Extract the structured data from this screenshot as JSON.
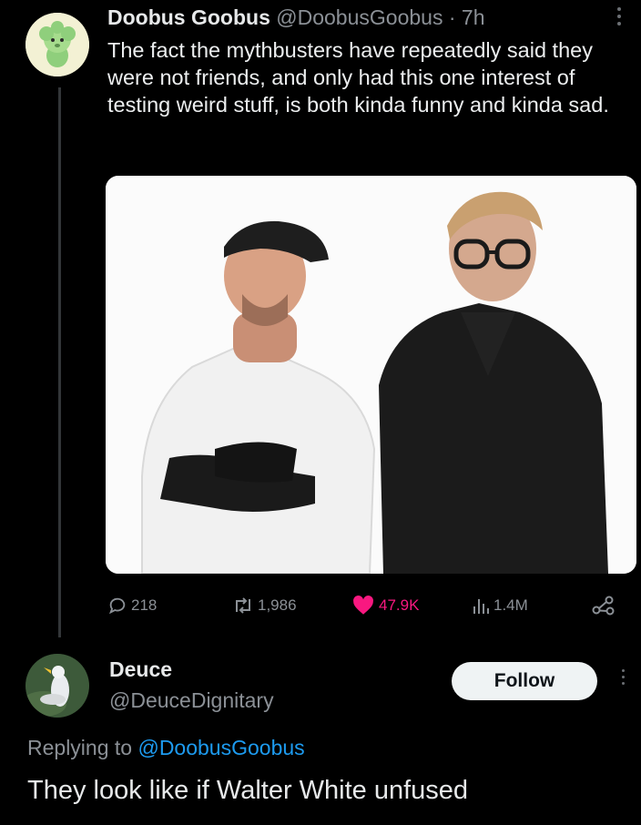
{
  "post": {
    "author_name": "Doobus Goobus",
    "author_handle": "@DoobusGoobus",
    "separator": "·",
    "time": "7h",
    "text": "The fact the mythbusters have repeatedly said they were not friends, and only had this one interest of testing weird stuff, is both kinda funny and kinda sad.",
    "stats": {
      "replies": "218",
      "reposts": "1,986",
      "likes": "47.9K",
      "views": "1.4M"
    },
    "icons": {
      "reply": "speech-bubble-icon",
      "repost": "repost-arrows-icon",
      "like": "heart-icon",
      "views": "bar-chart-icon",
      "share": "share-icon",
      "more": "more-vertical-icon"
    }
  },
  "reply": {
    "author_name": "Deuce",
    "author_handle": "@DeuceDignitary",
    "follow_label": "Follow",
    "replying_prefix": "Replying to",
    "replying_to": "@DoobusGoobus",
    "text": "They look like if Walter White unfused"
  },
  "colors": {
    "background": "#000000",
    "text": "#e7e9ea",
    "muted": "#8b9096",
    "like": "#f91880",
    "mention": "#1d9bf0"
  }
}
